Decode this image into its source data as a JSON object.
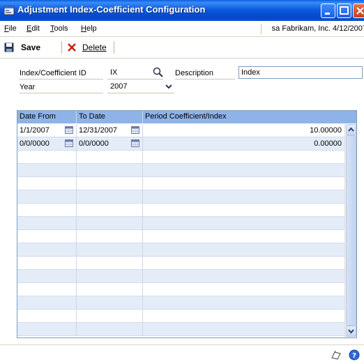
{
  "window": {
    "title": "Adjustment Index-Coefficient Configuration"
  },
  "menubar": {
    "items": [
      {
        "label": "File",
        "access_key": "F"
      },
      {
        "label": "Edit",
        "access_key": "E"
      },
      {
        "label": "Tools",
        "access_key": "T"
      },
      {
        "label": "Help",
        "access_key": "H"
      }
    ],
    "user_info": "sa  Fabrikam, Inc.  4/12/2007"
  },
  "toolbar": {
    "save_label": "Save",
    "delete_label": "Delete"
  },
  "form": {
    "id_label": "Index/Coefficient ID",
    "id_value": "IX",
    "description_label": "Description",
    "description_value": "Index",
    "year_label": "Year",
    "year_value": "2007"
  },
  "grid": {
    "columns": [
      "Date From",
      "To Date",
      "Period Coefficient/Index"
    ],
    "rows": [
      {
        "date_from": "1/1/2007",
        "to_date": "12/31/2007",
        "value": "10.00000"
      },
      {
        "date_from": "0/0/0000",
        "to_date": "0/0/0000",
        "value": "0.00000"
      }
    ],
    "empty_row_count": 14
  },
  "colors": {
    "titlebar": "#0a5be0",
    "grid_header": "#8eb3e8",
    "grid_alt_row": "#e4ecf8",
    "field_border": "#7f9db9"
  }
}
